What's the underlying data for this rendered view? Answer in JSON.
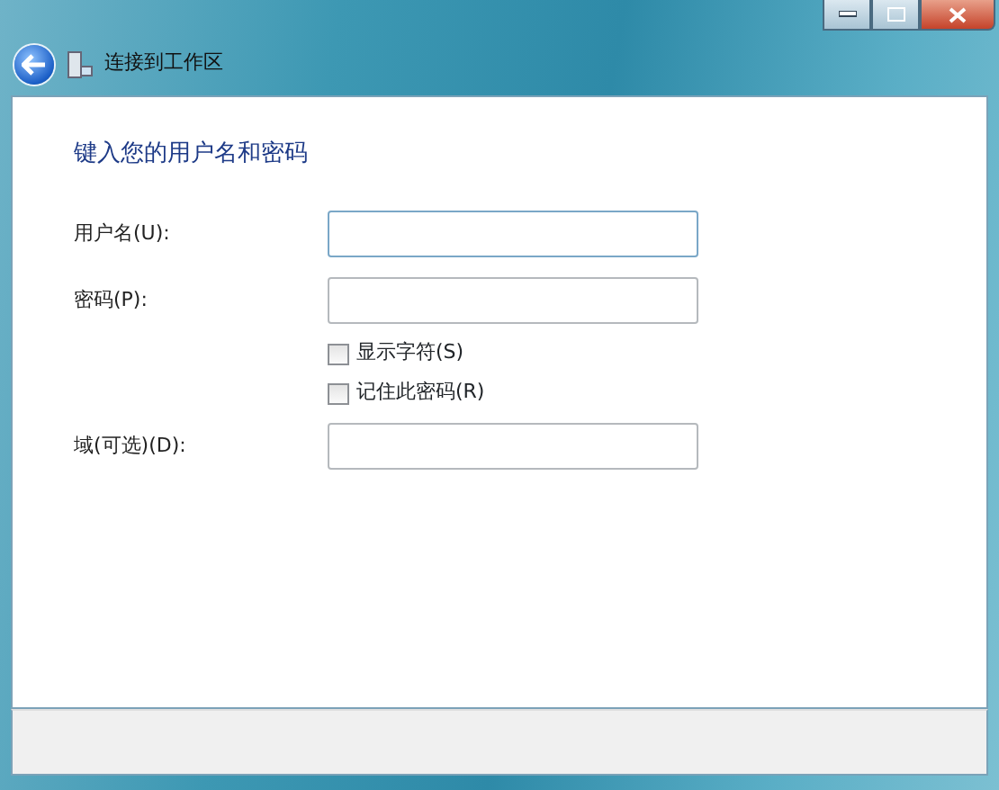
{
  "window": {
    "title": "连接到工作区"
  },
  "heading": "键入您的用户名和密码",
  "fields": [
    {
      "kind": "field",
      "label": "用户名(U):",
      "focused": true
    },
    {
      "kind": "field",
      "label": "密码(P):",
      "focused": false
    },
    {
      "kind": "checkbox",
      "label": "显示字符(S)",
      "checked": false
    },
    {
      "kind": "checkbox",
      "label": "记住此密码(R)",
      "checked": false
    },
    {
      "kind": "field",
      "label": "域(可选)(D):",
      "focused": false
    }
  ]
}
